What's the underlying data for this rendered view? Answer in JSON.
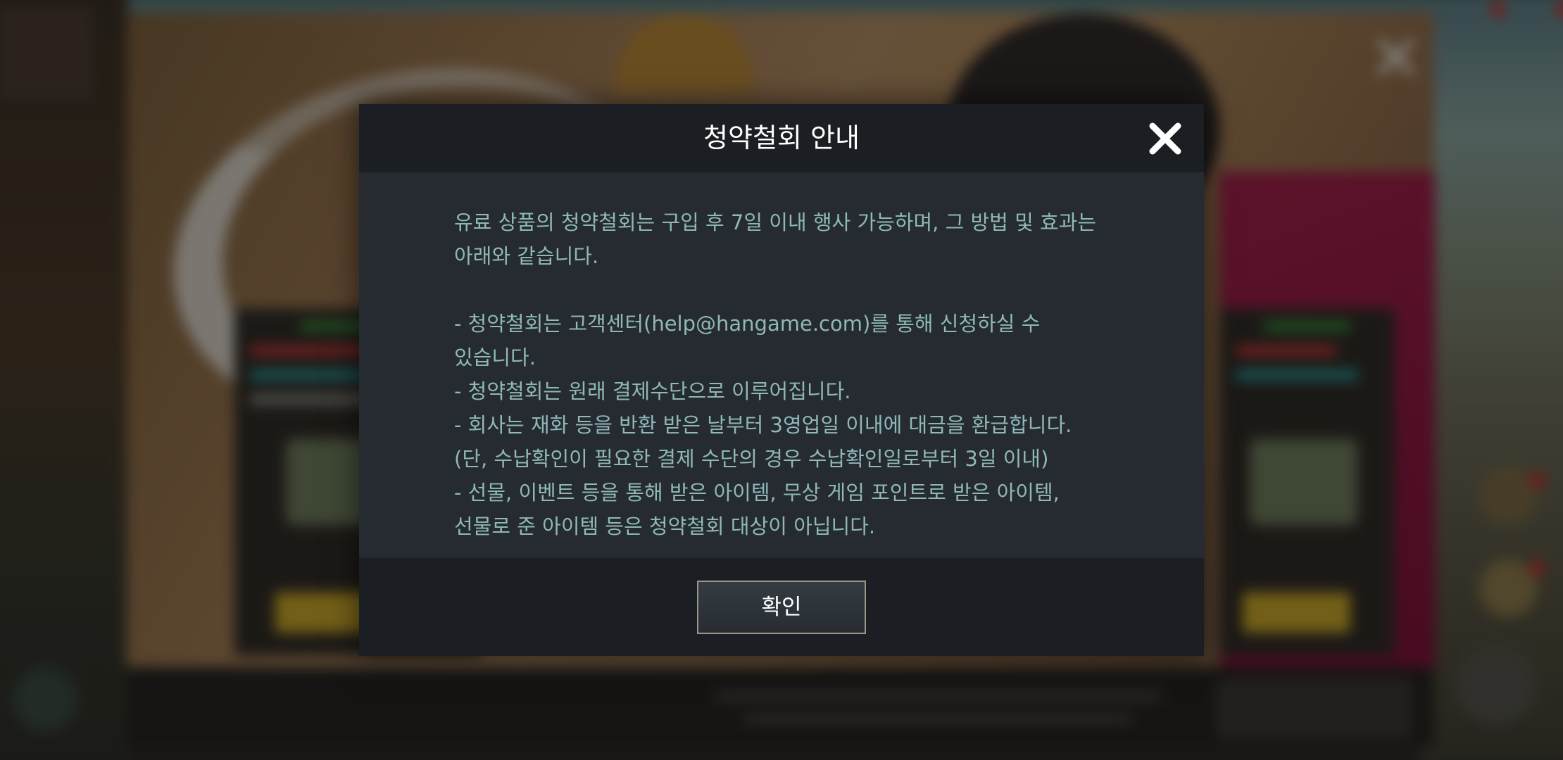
{
  "dialog": {
    "title": "청약철회 안내",
    "close_icon": "close-icon",
    "body_lines": [
      "유료 상품의 청약철회는 구입 후 7일 이내 행사 가능하며, 그 방법 및 효과는",
      "아래와 같습니다.",
      "",
      "- 청약철회는 고객센터(help@hangame.com)를 통해 신청하실 수",
      "있습니다.",
      "- 청약철회는 원래 결제수단으로 이루어집니다.",
      "- 회사는 재화 등을 반환 받은 날부터 3영업일 이내에 대금을 환급합니다.",
      "(단, 수납확인이 필요한 결제 수단의 경우 수납확인일로부터 3일 이내)",
      "- 선물, 이벤트 등을 통해 받은 아이템, 무상 게임 포인트로 받은 아이템,",
      "선물로 준 아이템 등은 청약철회 대상이 아닙니다."
    ],
    "confirm_label": "확인"
  },
  "colors": {
    "body_text": "#8fb8b7",
    "title_text": "#ffffff",
    "dialog_body_bg": "#252b31",
    "dialog_header_bg": "#1b1f23",
    "button_border": "#9c9484"
  }
}
